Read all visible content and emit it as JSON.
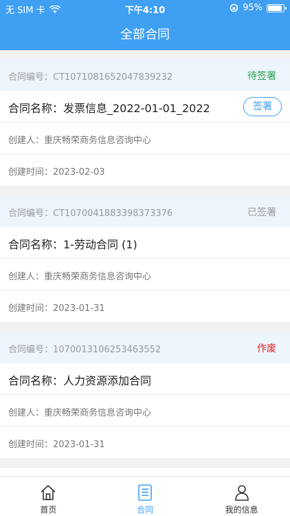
{
  "status_bar": {
    "carrier": "无 SIM 卡",
    "time": "下午4:10",
    "battery": "95%",
    "battery_level": 0.95
  },
  "header": {
    "title": "全部合同"
  },
  "contracts": [
    {
      "number": "合同编号：CT1071081652047839232",
      "status": "待签署",
      "status_color": "#2aa44f",
      "name": "合同名称：发票信息_2022-01-01_2022",
      "action": "签署",
      "creator": "创建人：重庆畅荣商务信息咨询中心",
      "created": "创建时间：2023-02-03"
    },
    {
      "number": "合同编号：CT1070041883398373376",
      "status": "已签署",
      "status_color": "#999999",
      "name": "合同名称：1-劳动合同 (1)",
      "creator": "创建人：重庆畅荣商务信息咨询中心",
      "created": "创建时间：2023-01-31"
    },
    {
      "number": "合同编号：1070013106253463552",
      "status": "作废",
      "status_color": "#e02020",
      "name": "合同名称：人力资源添加合同",
      "creator": "创建人：重庆畅荣商务信息咨询中心",
      "created": "创建时间：2023-01-31"
    }
  ],
  "tabs": [
    {
      "label": "首页",
      "icon": "home-icon"
    },
    {
      "label": "合同",
      "icon": "document-icon"
    },
    {
      "label": "我的信息",
      "icon": "user-icon"
    }
  ],
  "colors": {
    "accent": "#3f9ff3"
  }
}
